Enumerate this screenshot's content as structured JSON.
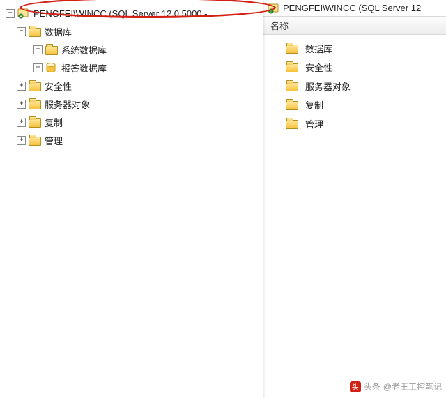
{
  "annotation_color": "#d22015",
  "server_label": "PENGFEI\\WINCC (SQL Server 12.0.5000 -",
  "tree": {
    "root": {
      "expanded": true,
      "children": [
        {
          "label": "数据库",
          "expanded": true,
          "icon": "folder",
          "children": [
            {
              "label": "系统数据库",
              "expanded": false,
              "icon": "folder",
              "hasToggle": true
            },
            {
              "label": "报答数据库",
              "expanded": false,
              "icon": "db",
              "hasToggle": true
            }
          ]
        },
        {
          "label": "安全性",
          "expanded": false,
          "icon": "folder",
          "hasToggle": true
        },
        {
          "label": "服务器对象",
          "expanded": false,
          "icon": "folder",
          "hasToggle": true
        },
        {
          "label": "复制",
          "expanded": false,
          "icon": "folder",
          "hasToggle": true
        },
        {
          "label": "管理",
          "expanded": false,
          "icon": "folder",
          "hasToggle": true
        }
      ]
    }
  },
  "right": {
    "breadcrumb": "PENGFEI\\WINCC (SQL Server 12",
    "column_header": "名称",
    "items": [
      {
        "label": "数据库"
      },
      {
        "label": "安全性"
      },
      {
        "label": "服务器对象"
      },
      {
        "label": "复制"
      },
      {
        "label": "管理"
      }
    ]
  },
  "watermark": {
    "source": "头条",
    "author": "@老王工控笔记"
  },
  "toggle_glyph": {
    "plus": "+",
    "minus": "−"
  }
}
